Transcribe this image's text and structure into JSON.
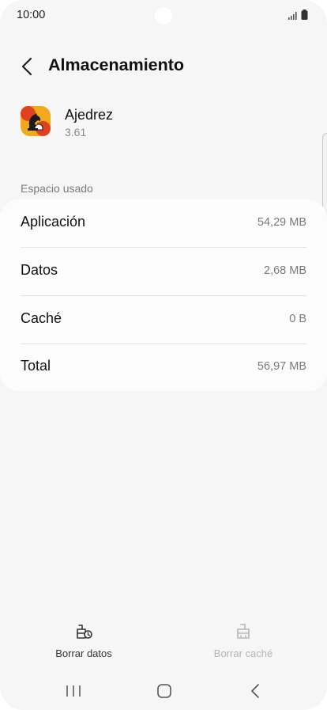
{
  "status_bar": {
    "time": "10:00"
  },
  "header": {
    "title": "Almacenamiento"
  },
  "app": {
    "name": "Ajedrez",
    "version": "3.61"
  },
  "storage": {
    "section_label": "Espacio usado",
    "rows": [
      {
        "label": "Aplicación",
        "value": "54,29 MB"
      },
      {
        "label": "Datos",
        "value": "2,68 MB"
      },
      {
        "label": "Caché",
        "value": "0 B"
      },
      {
        "label": "Total",
        "value": "56,97 MB"
      }
    ]
  },
  "actions": {
    "clear_data": {
      "label": "Borrar datos",
      "enabled": true,
      "color": "#333333"
    },
    "clear_cache": {
      "label": "Borrar caché",
      "enabled": false,
      "color": "#b5b5b5"
    }
  },
  "icons": {
    "back": "chevron-left-icon",
    "clear_data": "clear-data-icon",
    "clear_cache": "clear-cache-icon",
    "signal": "signal-icon",
    "battery": "battery-icon"
  }
}
